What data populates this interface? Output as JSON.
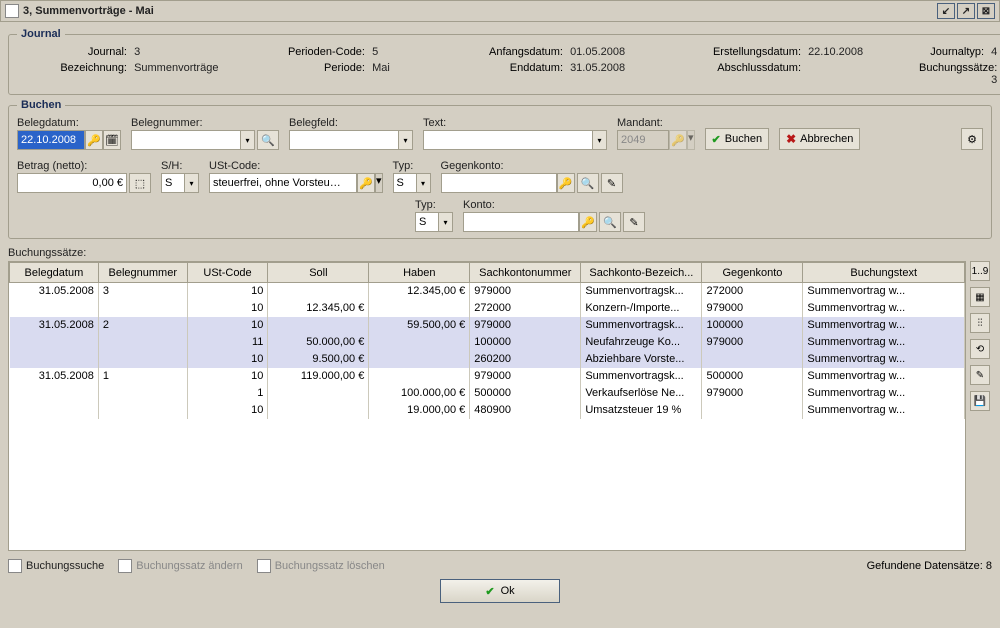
{
  "window": {
    "title": "3, Summenvorträge - Mai"
  },
  "journal": {
    "legend": "Journal",
    "l_journal": "Journal:",
    "v_journal": "3",
    "l_bez": "Bezeichnung:",
    "v_bez": "Summenvorträge",
    "l_pcode": "Perioden-Code:",
    "v_pcode": "5",
    "l_periode": "Periode:",
    "v_periode": "Mai",
    "l_start": "Anfangsdatum:",
    "v_start": "01.05.2008",
    "l_end": "Enddatum:",
    "v_end": "31.05.2008",
    "l_create": "Erstellungsdatum:",
    "v_create": "22.10.2008",
    "l_close": "Abschlussdatum:",
    "v_close": "",
    "l_type": "Journaltyp:",
    "v_type": "4",
    "l_rows": "Buchungssätze:",
    "v_rows": "3"
  },
  "buchen": {
    "legend": "Buchen",
    "l_belegdatum": "Belegdatum:",
    "v_belegdatum": "22.10.2008",
    "l_belegnr": "Belegnummer:",
    "l_belegfeld": "Belegfeld:",
    "l_text": "Text:",
    "l_mandant": "Mandant:",
    "v_mandant": "2049",
    "btn_buchen": "Buchen",
    "btn_abbrechen": "Abbrechen",
    "l_betrag": "Betrag (netto):",
    "v_betrag": "0,00 €",
    "l_sh": "S/H:",
    "v_sh": "S",
    "l_ust": "USt-Code:",
    "v_ust": "steuerfrei, ohne Vorsteu…",
    "l_typ": "Typ:",
    "v_typ1": "S",
    "v_typ2": "S",
    "l_gegen": "Gegenkonto:",
    "l_konto": "Konto:"
  },
  "table": {
    "label": "Buchungssätze:",
    "cols": [
      "Belegdatum",
      "Belegnummer",
      "USt-Code",
      "Soll",
      "Haben",
      "Sachkontonummer",
      "Sachkonto-Bezeich...",
      "Gegenkonto",
      "Buchungstext"
    ],
    "rows": [
      {
        "sel": false,
        "d": "31.05.2008",
        "n": "3",
        "u": "10",
        "s": "",
        "h": "12.345,00 €",
        "k": "979000",
        "kb": "Summenvortragsk...",
        "g": "272000",
        "t": "Summenvortrag w..."
      },
      {
        "sel": false,
        "d": "",
        "n": "",
        "u": "10",
        "s": "12.345,00 €",
        "h": "",
        "k": "272000",
        "kb": "Konzern-/Importe...",
        "g": "979000",
        "t": "Summenvortrag w..."
      },
      {
        "sel": true,
        "d": "31.05.2008",
        "n": "2",
        "u": "10",
        "s": "",
        "h": "59.500,00 €",
        "k": "979000",
        "kb": "Summenvortragsk...",
        "g": "100000",
        "t": "Summenvortrag w..."
      },
      {
        "sel": true,
        "d": "",
        "n": "",
        "u": "11",
        "s": "50.000,00 €",
        "h": "",
        "k": "100000",
        "kb": "Neufahrzeuge Ko...",
        "g": "979000",
        "t": "Summenvortrag w..."
      },
      {
        "sel": true,
        "d": "",
        "n": "",
        "u": "10",
        "s": "9.500,00 €",
        "h": "",
        "k": "260200",
        "kb": "Abziehbare Vorste...",
        "g": "",
        "t": "Summenvortrag w..."
      },
      {
        "sel": false,
        "d": "31.05.2008",
        "n": "1",
        "u": "10",
        "s": "119.000,00 €",
        "h": "",
        "k": "979000",
        "kb": "Summenvortragsk...",
        "g": "500000",
        "t": "Summenvortrag w..."
      },
      {
        "sel": false,
        "d": "",
        "n": "",
        "u": "1",
        "s": "",
        "h": "100.000,00 €",
        "k": "500000",
        "kb": "Verkaufserlöse Ne...",
        "g": "979000",
        "t": "Summenvortrag w..."
      },
      {
        "sel": false,
        "d": "",
        "n": "",
        "u": "10",
        "s": "",
        "h": "19.000,00 €",
        "k": "480900",
        "kb": "Umsatzsteuer 19 %",
        "g": "",
        "t": "Summenvortrag w..."
      }
    ]
  },
  "footer": {
    "search": "Buchungssuche",
    "edit": "Buchungssatz ändern",
    "del": "Buchungssatz löschen",
    "found": "Gefundene Datensätze: 8",
    "ok": "Ok"
  }
}
